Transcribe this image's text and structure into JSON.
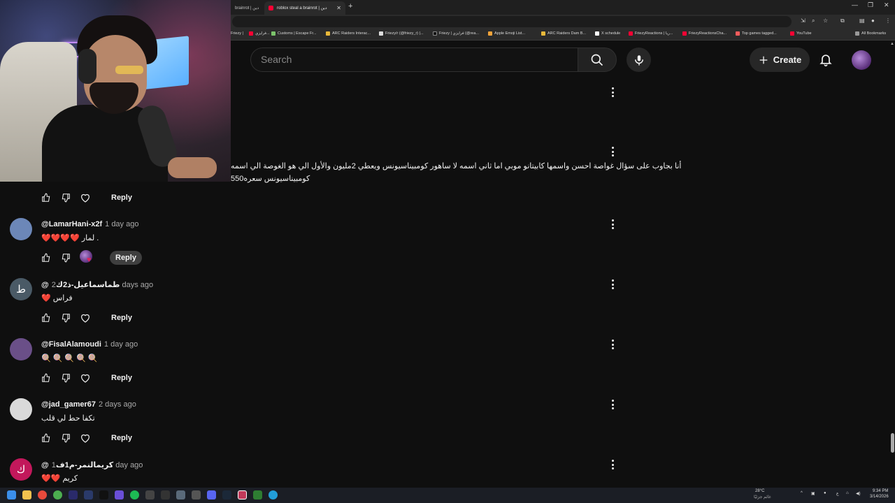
{
  "browser": {
    "tabs": [
      {
        "title": "brainrot | دين",
        "active": false
      },
      {
        "title": "roblox steal a brainrot | دين",
        "active": true
      }
    ],
    "new_tab": "+",
    "window_controls": [
      "—",
      "❐",
      "✕"
    ],
    "bookmarks": [
      "Friezy |",
      "فرايزي...",
      "Customs | Escape Fr...",
      "ARC Raiders Interac...",
      "Friezy/r (@friezy_r) |...",
      "Friezy | فرايزي (@rea...",
      "Apple Emoji List...",
      "ARC Raiders Dam B...",
      "X schedule",
      "FriezyReactions | ريا...",
      "FriezyReactionsCha...",
      "Top games tagged...",
      "YouTube",
      "All Bookmarks"
    ]
  },
  "masthead": {
    "search_placeholder": "Search",
    "create_label": "Create"
  },
  "comments_partial": {
    "text_line1": "أنا بجاوب على سؤال غواصة احسن واسمها كابيتانو موبي اما ثاني اسمه لا ساهور كومبيناسيونس ويعطي 2مليون والأول الي هو الغوصة الي اسمه",
    "text_line2": "كومبيناسيونس سعره550",
    "reply_label": "Reply"
  },
  "comments": [
    {
      "author": "@LamarHani-x2f",
      "time": "1 day ago",
      "text": "لمار .",
      "hearts": "❤️❤️❤️❤️",
      "avatar_char": "",
      "avatar_color": "#6c87b8",
      "reply_label": "Reply",
      "hearted": true
    },
    {
      "author": "@طماسماعيل-ذ2ك",
      "time": "2 days ago",
      "text": "فراس",
      "hearts": "❤️",
      "avatar_char": "ط",
      "avatar_color": "#4a5a66",
      "reply_label": "Reply",
      "hearted": false
    },
    {
      "author": "@FisalAlamoudi",
      "time": "1 day ago",
      "text": "",
      "hearts": "🍭🍭🍭🍭🍭",
      "avatar_char": "",
      "avatar_color": "#6a4f88",
      "reply_label": "Reply",
      "hearted": false
    },
    {
      "author": "@jad_gamer67",
      "time": "2 days ago",
      "text": "تكفا حط لي قلب",
      "hearts": "",
      "avatar_char": "",
      "avatar_color": "#d9d9d9",
      "reply_label": "Reply",
      "hearted": false
    },
    {
      "author": "@كريمالنمر-م1ف",
      "time": "1 day ago",
      "text": "كريم",
      "hearts": "❤️❤️",
      "avatar_char": "ك",
      "avatar_color": "#c2185b",
      "reply_label": "Reply",
      "hearted": false
    }
  ],
  "taskbar": {
    "weather": "28°C",
    "weather_sub": "غائم جزئيًا",
    "time": "9:34 PM",
    "date": "3/14/2026",
    "lang": "ع"
  },
  "colors": {
    "background": "#0f0f0f",
    "heart": "#e0245e",
    "accent": "#ff0033"
  }
}
